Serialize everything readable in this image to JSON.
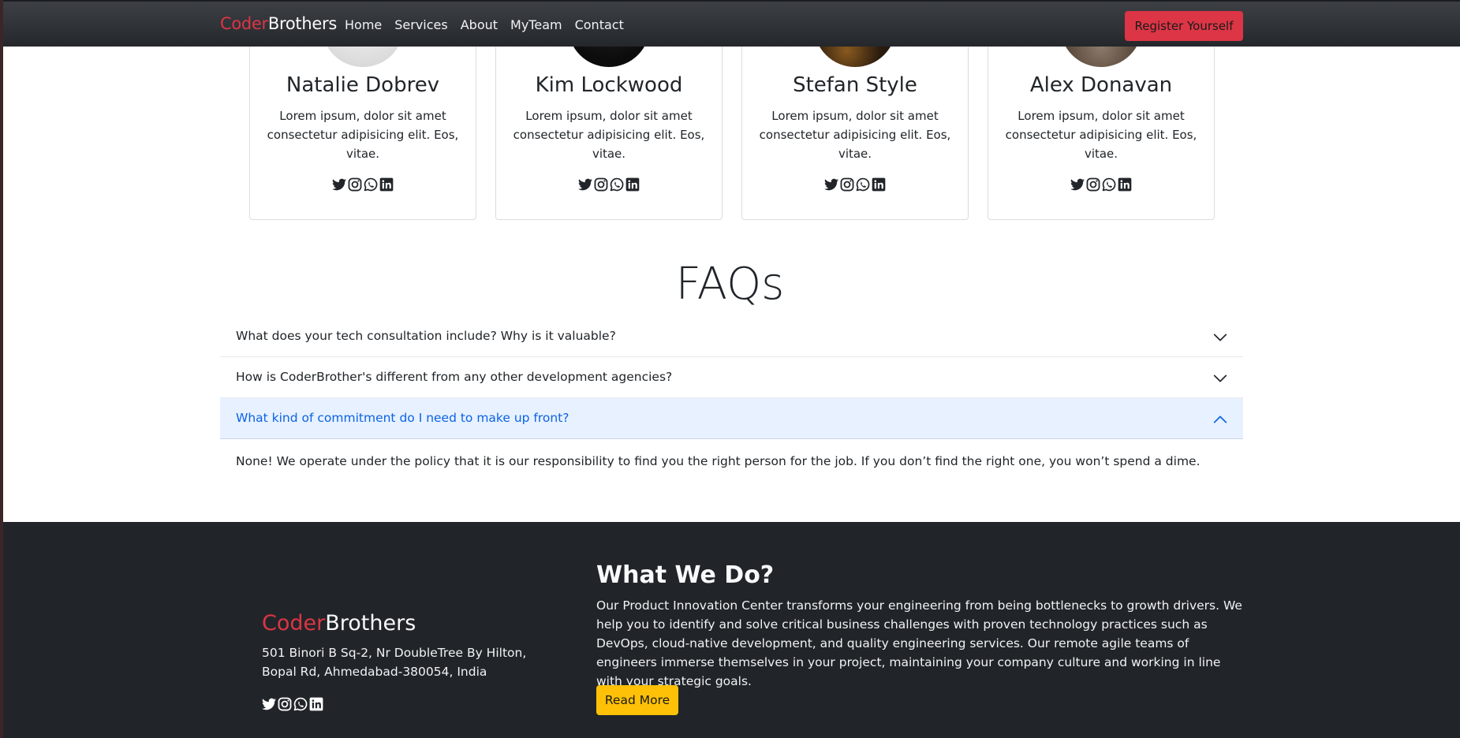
{
  "navbar": {
    "brand_part1": "Coder",
    "brand_part2": "Brothers",
    "links": [
      "Home",
      "Services",
      "About",
      "MyTeam",
      "Contact"
    ],
    "register_label": "Register Yourself"
  },
  "team": [
    {
      "name": "Natalie Dobrev",
      "text": "Lorem ipsum, dolor sit amet consectetur adipisicing elit. Eos, vitae."
    },
    {
      "name": "Kim Lockwood",
      "text": "Lorem ipsum, dolor sit amet consectetur adipisicing elit. Eos, vitae."
    },
    {
      "name": "Stefan Style",
      "text": "Lorem ipsum, dolor sit amet consectetur adipisicing elit. Eos, vitae."
    },
    {
      "name": "Alex Donavan",
      "text": "Lorem ipsum, dolor sit amet consectetur adipisicing elit. Eos, vitae."
    }
  ],
  "social_icons": [
    "twitter-icon",
    "instagram-icon",
    "whatsapp-icon",
    "linkedin-icon"
  ],
  "faq": {
    "title": "FAQs",
    "items": [
      {
        "question": "What does your tech consultation include? Why is it valuable?",
        "expanded": false
      },
      {
        "question": "How is CoderBrother's different from any other development agencies?",
        "expanded": false
      },
      {
        "question": "What kind of commitment do I need to make up front?",
        "expanded": true
      }
    ],
    "open_answer": "None! We operate under the policy that it is our responsibility to find you the right person for the job. If you don’t find the right one, you won’t spend a dime."
  },
  "footer": {
    "brand_part1": "Coder",
    "brand_part2": "Brothers",
    "address": "501 Binori B Sq-2, Nr DoubleTree By Hilton, Bopal Rd, Ahmedabad-380054, India",
    "heading": "What We Do?",
    "paragraph": "Our Product Innovation Center transforms your engineering from being bottlenecks to growth drivers. We help you to identify and solve critical business challenges with proven technology practices such as DevOps, cloud-native development, and quality engineering services. Our remote agile teams of engineers immerse themselves in your project, maintaining your company culture and working in line with your strategic goals.",
    "read_more_label": "Read More"
  },
  "colors": {
    "brand_red": "#dc3545",
    "footer_bg": "#212529",
    "accordion_active_bg": "#e7f1ff",
    "accordion_active_text": "#0c63e4",
    "read_more_yellow": "#ffc107"
  }
}
